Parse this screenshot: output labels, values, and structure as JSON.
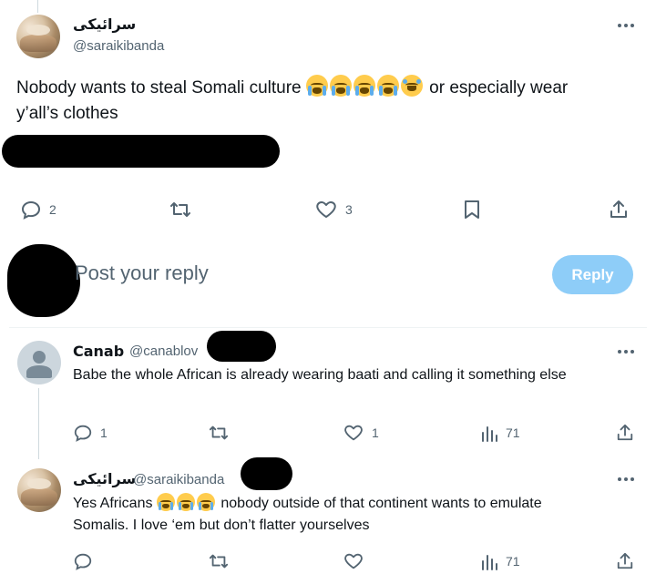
{
  "main_tweet": {
    "display_name": "سرائیکی",
    "handle": "@saraikibanda",
    "text_line1": "Nobody wants to steal Somali culture",
    "text_line1_tail": "or especially wear",
    "text_line2": "y’all’s clothes",
    "emojis": [
      "loudly-crying-face",
      "loudly-crying-face",
      "loudly-crying-face",
      "loudly-crying-face",
      "face-with-tears-of-joy"
    ],
    "replies_count": "2",
    "likes_count": "3"
  },
  "reply_composer": {
    "placeholder": "Post your reply",
    "button_label": "Reply"
  },
  "replies": [
    {
      "display_name": "Canab",
      "handle": "@canablov",
      "text": "Babe the whole African is already wearing baati and calling it something else",
      "replies_count": "1",
      "likes_count": "1",
      "views_count": "71"
    },
    {
      "display_name": "سرائیکی",
      "handle": "@saraikibanda",
      "text_before_emoji": "Yes Africans",
      "text_after_emoji": "nobody outside of that continent wants to emulate",
      "text_line2": "Somalis. I love ‘em but don’t flatter yourselves",
      "emojis": [
        "loudly-crying-face",
        "loudly-crying-face",
        "loudly-crying-face"
      ],
      "views_count": "71"
    }
  ],
  "colors": {
    "accent_button": "#8ecdf8",
    "secondary_text": "#536471",
    "primary_text": "#0f1419",
    "divider": "#eff3f4"
  }
}
